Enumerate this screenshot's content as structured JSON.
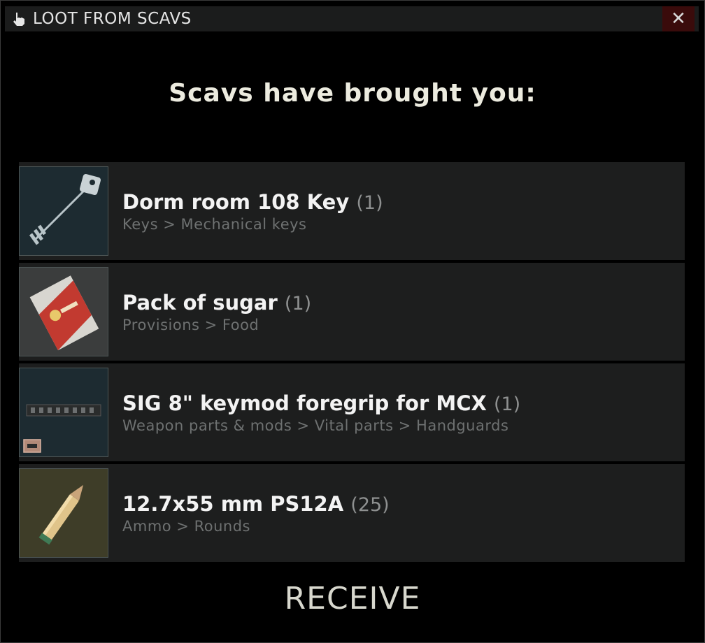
{
  "window": {
    "title": "LOOT FROM SCAVS",
    "close_label": "✕"
  },
  "heading": "Scavs have brought you:",
  "items": [
    {
      "name": "Dorm room 108 Key",
      "qty": "(1)",
      "category": "Keys > Mechanical keys",
      "icon": "key-icon"
    },
    {
      "name": "Pack of sugar",
      "qty": "(1)",
      "category": "Provisions > Food",
      "icon": "sugar-pack-icon"
    },
    {
      "name": "SIG 8\" keymod foregrip for MCX",
      "qty": "(1)",
      "category": "Weapon parts & mods > Vital parts > Handguards",
      "icon": "handguard-icon"
    },
    {
      "name": "12.7x55 mm PS12A",
      "qty": "(25)",
      "category": "Ammo > Rounds",
      "icon": "ammo-round-icon"
    }
  ],
  "receive_label": "RECEIVE",
  "colors": {
    "background": "#000000",
    "row_bg": "#1d1e1e",
    "titlebar_bg": "#1b1c1c",
    "close_bg": "#3a0b0b"
  }
}
